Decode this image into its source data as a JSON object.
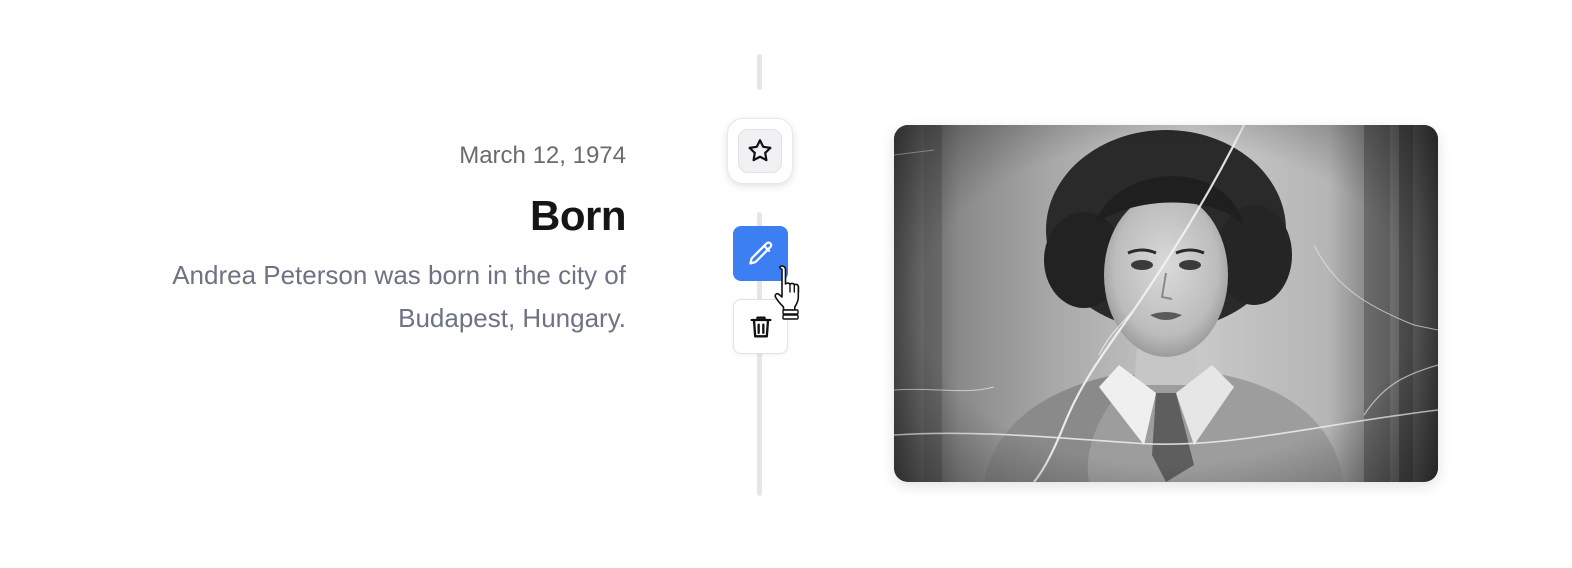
{
  "event": {
    "date": "March 12, 1974",
    "title": "Born",
    "description": "Andrea Peterson was born in the city of Budapest, Hungary."
  },
  "node": {
    "icon": "star-icon"
  },
  "actions": {
    "edit_icon": "pencil-icon",
    "delete_icon": "trash-icon"
  },
  "colors": {
    "accent": "#3b7ff2",
    "timeline": "#e6e6e6",
    "title": "#151515",
    "description": "#6d7383",
    "date": "#6b6b6b"
  },
  "photo": {
    "subject": "vintage black-and-white portrait"
  }
}
